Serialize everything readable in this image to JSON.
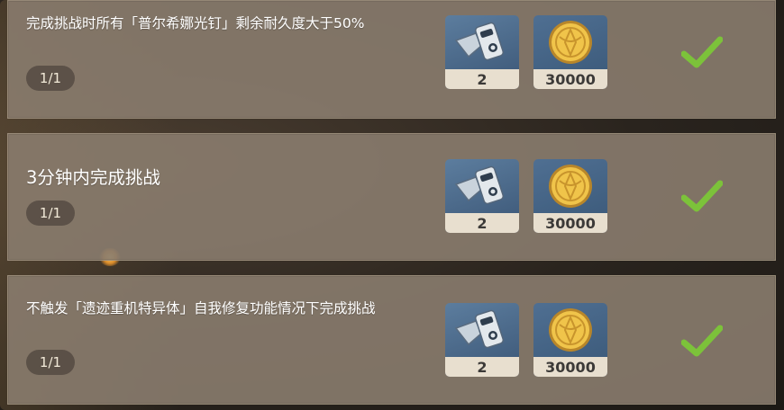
{
  "tasks": [
    {
      "title": "完成挑战时所有「普尔希娜光钉」剩余耐久度大于50%",
      "progress": "1/1",
      "completed": true,
      "rewards": [
        {
          "icon": "material-icon",
          "count": "2"
        },
        {
          "icon": "mora-coin-icon",
          "count": "30000"
        }
      ]
    },
    {
      "title": "3分钟内完成挑战",
      "progress": "1/1",
      "completed": true,
      "rewards": [
        {
          "icon": "material-icon",
          "count": "2"
        },
        {
          "icon": "mora-coin-icon",
          "count": "30000"
        }
      ]
    },
    {
      "title": "不触发「遗迹重机特异体」自我修复功能情况下完成挑战",
      "progress": "1/1",
      "completed": true,
      "rewards": [
        {
          "icon": "material-icon",
          "count": "2"
        },
        {
          "icon": "mora-coin-icon",
          "count": "30000"
        }
      ]
    }
  ],
  "colors": {
    "panel": "#897c6e",
    "check": "#7cc23a",
    "badge": "#463e37",
    "count_strip": "#e8dfcf"
  }
}
